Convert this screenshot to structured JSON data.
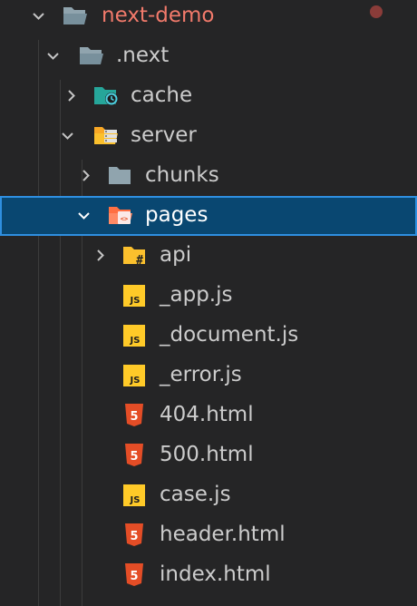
{
  "explorer": {
    "root": {
      "label": "next-demo",
      "modified_dot": "orange-red",
      "color": "#f27a6b"
    },
    "items": [
      {
        "label": "next-demo",
        "type": "folder",
        "expanded": true,
        "icon": "folder-open-icon"
      },
      {
        "label": ".next",
        "type": "folder",
        "expanded": true,
        "icon": "folder-open-icon"
      },
      {
        "label": "cache",
        "type": "folder",
        "expanded": false,
        "icon": "folder-cache-icon"
      },
      {
        "label": "server",
        "type": "folder",
        "expanded": true,
        "icon": "folder-server-icon"
      },
      {
        "label": "chunks",
        "type": "folder",
        "expanded": false,
        "icon": "folder-icon"
      },
      {
        "label": "pages",
        "type": "folder",
        "expanded": true,
        "selected": true,
        "icon": "folder-pages-icon"
      },
      {
        "label": "api",
        "type": "folder",
        "expanded": false,
        "icon": "folder-api-icon"
      },
      {
        "label": "_app.js",
        "type": "file",
        "icon": "js-icon"
      },
      {
        "label": "_document.js",
        "type": "file",
        "icon": "js-icon"
      },
      {
        "label": "_error.js",
        "type": "file",
        "icon": "js-icon"
      },
      {
        "label": "404.html",
        "type": "file",
        "icon": "html5-icon"
      },
      {
        "label": "500.html",
        "type": "file",
        "icon": "html5-icon"
      },
      {
        "label": "case.js",
        "type": "file",
        "icon": "js-icon"
      },
      {
        "label": "header.html",
        "type": "file",
        "icon": "html5-icon"
      },
      {
        "label": "index.html",
        "type": "file",
        "icon": "html5-icon"
      }
    ]
  },
  "icon_glyphs": {
    "js": "JS",
    "html5": "5",
    "api": "#",
    "pages": "<>"
  },
  "colors": {
    "background": "#252526",
    "selection": "#094771",
    "selection_border": "#2f8fe0",
    "folder_gray": "#90a4ae",
    "folder_teal": "#26a69a",
    "folder_yellow": "#fbc02d",
    "folder_red": "#ff7043",
    "js_yellow": "#ffca28",
    "html_orange": "#e44d26",
    "text": "#cccccc"
  }
}
